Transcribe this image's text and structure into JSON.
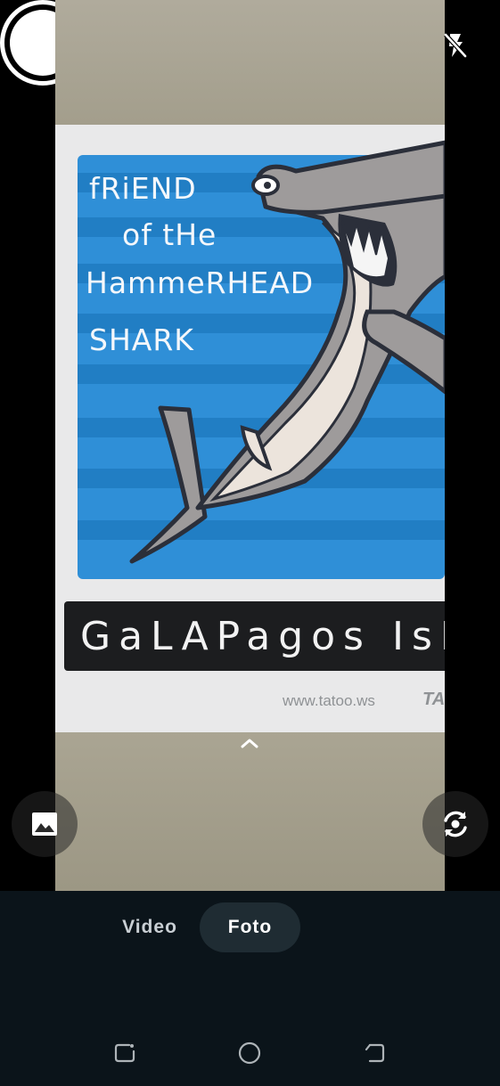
{
  "camera": {
    "modes": [
      {
        "label": "Video",
        "selected": false
      },
      {
        "label": "Foto",
        "selected": true
      }
    ],
    "icons": {
      "close": "close-icon",
      "flash": "flash-off-icon",
      "expand": "chevron-up-icon",
      "gallery": "image-icon",
      "switch_camera": "switch-camera-icon",
      "shutter": "shutter-button"
    }
  },
  "preview": {
    "sticker_lines": [
      "fRiEND",
      "of tHe",
      "HammeRHEAD",
      "SHARK"
    ],
    "banner": "GaLAPagos IsLan",
    "url": "www.tatoo.ws",
    "url_mark": "TA"
  },
  "navigation_bar": {
    "icons": [
      "recent-apps-icon",
      "home-icon",
      "back-icon"
    ]
  },
  "colors": {
    "sea_blue": "#2f8fd7",
    "shark_gray": "#9e9b9b",
    "mode_bar": "#0b141a",
    "selected_pill": "#1f2c33"
  }
}
